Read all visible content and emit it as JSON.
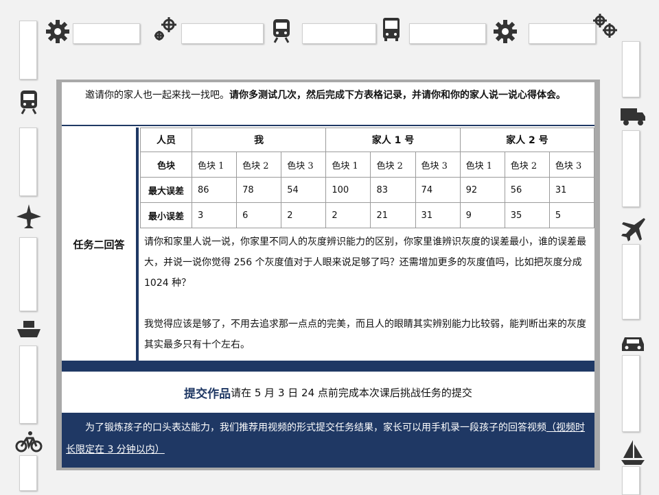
{
  "intro": {
    "normal": "邀请你的家人也一起来找一找吧。",
    "bold": "请你多测试几次，然后完成下方表格记录，并请你和你的家人说一说心得体会。"
  },
  "task_label": "任务二回答",
  "table": {
    "person_header": "人员",
    "groups": [
      "我",
      "家人 1 号",
      "家人 2 号"
    ],
    "color_label": "色块",
    "blocks": [
      "色块 1",
      "色块 2",
      "色块 3",
      "色块 1",
      "色块 2",
      "色块 3",
      "色块 1",
      "色块 2",
      "色块 3"
    ],
    "rows": [
      {
        "label": "最大误差",
        "values": [
          "86",
          "78",
          "54",
          "100",
          "83",
          "74",
          "92",
          "56",
          "31"
        ]
      },
      {
        "label": "最小误差",
        "values": [
          "3",
          "6",
          "2",
          "2",
          "21",
          "31",
          "9",
          "35",
          "5"
        ]
      }
    ]
  },
  "question": "请你和家里人说一说，你家里不同人的灰度辨识能力的区别，你家里谁辨识灰度的误差最小，谁的误差最大，并说一说你觉得 256 个灰度值对于人眼来说足够了吗？还需增加更多的灰度值吗，比如把灰度分成 1024 种？",
  "answer": "我觉得应该是够了，不用去追求那一点点的完美，而且人的眼睛其实辨别能力比较弱，能判断出来的灰度其实最多只有十个左右。",
  "submit": {
    "strong": "提交作品",
    "text": "请在 5 月 3 日 24 点前完成本次课后挑战任务的提交"
  },
  "bottom": {
    "text": "为了锻炼孩子的口头表达能力，我们推荐用视频的形式提交任务结果，家长可以用手机录一段孩子的回答视频",
    "note": "（视频时长限定在 3 分钟以内）"
  },
  "decor_icons": [
    "gear-icon",
    "gears-icon",
    "train-icon",
    "bus-icon",
    "gear-icon",
    "gears-icon",
    "train-icon",
    "airplane-icon",
    "ship-icon",
    "bicycle-icon",
    "truck-icon",
    "airplane-icon",
    "car-icon",
    "sailboat-icon"
  ],
  "colors": {
    "navy": "#1f3864",
    "frame": "#a9a9a9"
  }
}
